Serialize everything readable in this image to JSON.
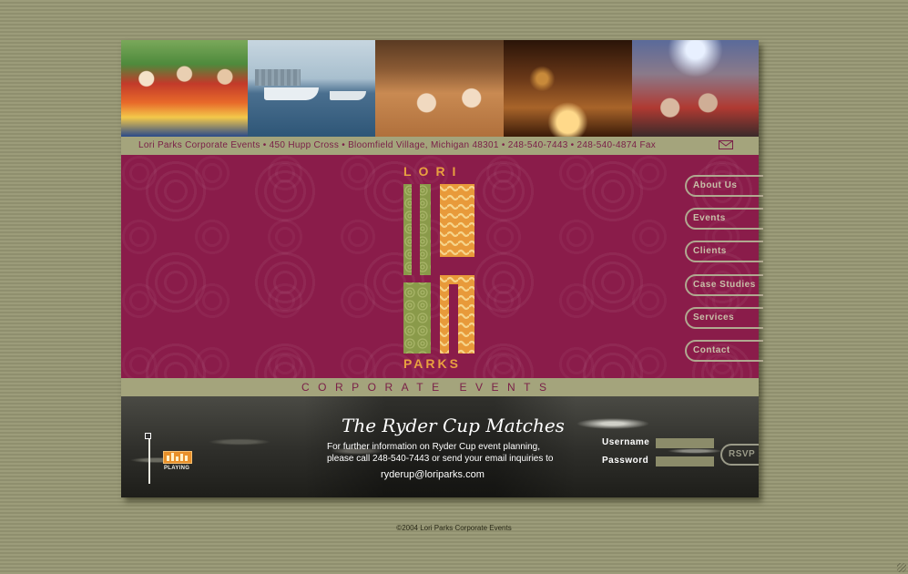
{
  "header": {
    "photos": [
      "folklorico-dancers-photo",
      "speedboats-photo",
      "banquet-hall-photo",
      "candlelit-dining-photo",
      "concert-crowd-photo"
    ],
    "address_line": "Lori Parks Corporate Events • 450 Hupp Cross • Bloomfield Village, Michigan 48301 • 248-540-7443 • 248-540-4874 Fax",
    "mail_icon": "envelope-icon"
  },
  "logo": {
    "top_text": "LORI",
    "bottom_text": "PARKS"
  },
  "nav": {
    "items": [
      {
        "label": "About Us"
      },
      {
        "label": "Events"
      },
      {
        "label": "Clients"
      },
      {
        "label": "Case Studies"
      },
      {
        "label": "Services"
      },
      {
        "label": "Contact"
      }
    ]
  },
  "tagline": "CORPORATE EVENTS",
  "feature": {
    "title": "The Ryder Cup Matches",
    "line1": "For further information on Ryder Cup event planning,",
    "line2": "please call 248-540-7443 or send your email inquiries to",
    "email": "ryderup@loriparks.com"
  },
  "player": {
    "status_label": "PLAYING"
  },
  "login": {
    "username_label": "Username",
    "password_label": "Password",
    "username_value": "",
    "password_value": "",
    "rsvp_label": "RSVP"
  },
  "footer": {
    "copyright": "©2004 Lori Parks Corporate Events"
  },
  "colors": {
    "background": "#9a9a78",
    "accent": "#8a1c4a",
    "band": "#a4a47c",
    "logo": "#e8a040"
  }
}
